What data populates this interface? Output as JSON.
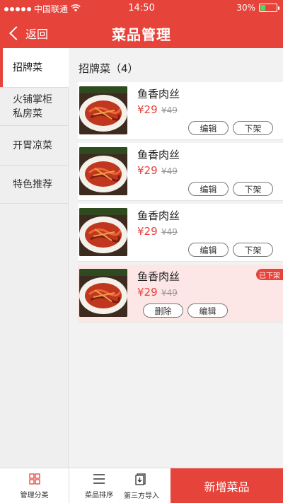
{
  "status": {
    "carrier": "中国联通",
    "time": "14:50",
    "battery": "30%",
    "battery_level": 0.3
  },
  "nav": {
    "back_label": "返回",
    "title": "菜品管理"
  },
  "sidebar": {
    "items": [
      {
        "label": "招牌菜"
      },
      {
        "label": "火铺掌柜\n私房菜"
      },
      {
        "label": "开胃凉菜"
      },
      {
        "label": "特色推荐"
      }
    ]
  },
  "main": {
    "category_title": "招牌菜（4）",
    "dishes": [
      {
        "name": "鱼香肉丝",
        "price": "¥29",
        "orig_price": "¥49",
        "btn1": "编辑",
        "btn2": "下架"
      },
      {
        "name": "鱼香肉丝",
        "price": "¥29",
        "orig_price": "¥49",
        "btn1": "编辑",
        "btn2": "下架"
      },
      {
        "name": "鱼香肉丝",
        "price": "¥29",
        "orig_price": "¥49",
        "btn1": "编辑",
        "btn2": "下架"
      },
      {
        "name": "鱼香肉丝",
        "price": "¥29",
        "orig_price": "¥49",
        "btn1": "删除",
        "btn2": "编辑",
        "badge": "已下架"
      }
    ]
  },
  "bottom": {
    "tab1": "管理分类",
    "tab2": "菜品排序",
    "tab3": "第三方导入",
    "add_label": "新增菜品"
  },
  "colors": {
    "accent": "#e6433b",
    "removed_bg": "#fde6e6"
  }
}
